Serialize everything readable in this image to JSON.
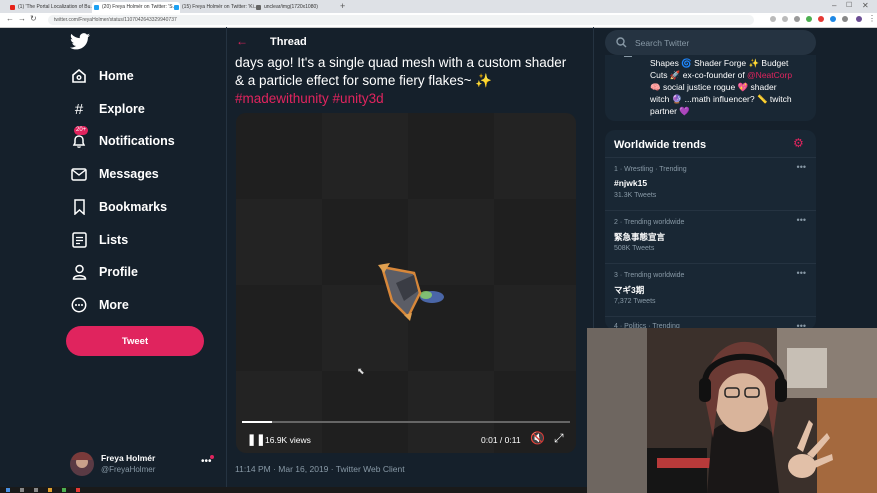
{
  "browser": {
    "tabs": [
      {
        "title": "(1) 'The Portal Localization of Bu..."
      },
      {
        "title": "(20) Freya Holmér on Twitter: 'S..."
      },
      {
        "title": "(15) Freya Holmér on Twitter: 'Ki..."
      },
      {
        "title": "unclear/img(1720x1080)"
      }
    ],
    "url": "twitter.com/FreyaHolmer/status/1107042643329940737"
  },
  "nav": {
    "home": "Home",
    "explore": "Explore",
    "notifications": "Notifications",
    "notifications_badge": "20+",
    "messages": "Messages",
    "bookmarks": "Bookmarks",
    "lists": "Lists",
    "profile": "Profile",
    "more": "More",
    "tweet_button": "Tweet"
  },
  "account": {
    "name": "Freya Holmér",
    "handle": "@FreyaHolmer"
  },
  "thread": {
    "header": "Thread",
    "text_line1": "days ago! It's a single quad mesh with a custom shader",
    "text_line2": "& a particle effect for some fiery flakes~",
    "sparkle": "✨",
    "hashtags": "#madewithunity #unity3d",
    "views": "16.9K views",
    "time": "0:01 / 0:11",
    "progress": 0.09,
    "timestamp": "11:14 PM · Mar 16, 2019 · Twitter Web Client"
  },
  "search": {
    "placeholder": "Search Twitter"
  },
  "bio": {
    "line1": "Shapes 🌀 Shader Forge ✨ Budget",
    "line2a": "Cuts 🚀 ex-co-founder of ",
    "line2b": "@NeatCorp",
    "line3": "🧠 social justice rogue 💖 shader",
    "line4": "witch 🔮 ...math influencer? 📏 twitch",
    "line5": "partner 💜"
  },
  "trends": {
    "title": "Worldwide trends",
    "items": [
      {
        "meta": "1 · Wrestling · Trending",
        "name": "#njwk15",
        "count": "31.3K Tweets"
      },
      {
        "meta": "2 · Trending worldwide",
        "name": "緊急事態宣言",
        "count": "508K Tweets"
      },
      {
        "meta": "3 · Trending worldwide",
        "name": "マギ3期",
        "count": "7,372 Tweets"
      },
      {
        "meta": "4 · Politics · Trending",
        "name": "",
        "count": ""
      }
    ]
  },
  "colors": {
    "background": "#15202b",
    "accent": "#e0245e",
    "muted": "#8899a6"
  }
}
